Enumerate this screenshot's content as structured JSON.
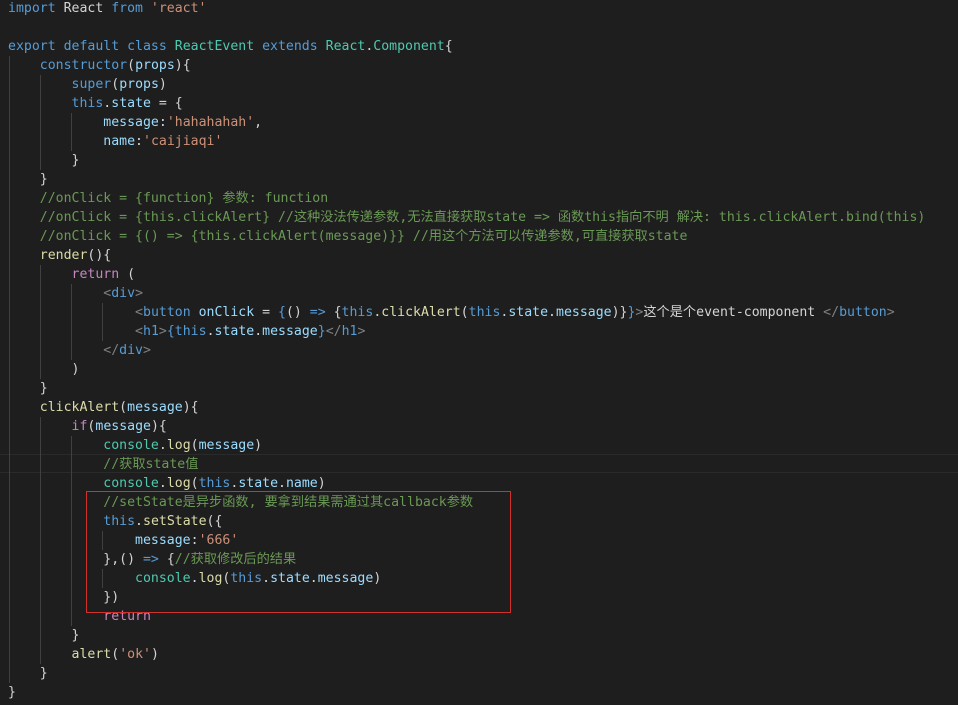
{
  "editor": {
    "theme": {
      "background": "#1e1e1e",
      "keyword": "#569cd6",
      "control": "#c586c0",
      "type": "#4ec9b0",
      "function": "#dcdcaa",
      "variable": "#9cdcfe",
      "string": "#ce9178",
      "comment": "#6a9955",
      "highlight_box": "#d0312d"
    },
    "lines": [
      [
        [
          "kw",
          "import "
        ],
        [
          "pl",
          "React "
        ],
        [
          "kw",
          "from "
        ],
        [
          "st",
          "'react'"
        ]
      ],
      [],
      [
        [
          "kw",
          "export "
        ],
        [
          "kw",
          "default "
        ],
        [
          "kw",
          "class "
        ],
        [
          "ty",
          "ReactEvent "
        ],
        [
          "kw",
          "extends "
        ],
        [
          "ty",
          "React"
        ],
        [
          "pl",
          "."
        ],
        [
          "ty",
          "Component"
        ],
        [
          "pl",
          "{"
        ]
      ],
      [
        [
          "pl",
          "    "
        ],
        [
          "kw",
          "constructor"
        ],
        [
          "pl",
          "("
        ],
        [
          "va",
          "props"
        ],
        [
          "pl",
          "){"
        ]
      ],
      [
        [
          "pl",
          "        "
        ],
        [
          "kw",
          "super"
        ],
        [
          "pl",
          "("
        ],
        [
          "va",
          "props"
        ],
        [
          "pl",
          ")"
        ]
      ],
      [
        [
          "pl",
          "        "
        ],
        [
          "kw",
          "this"
        ],
        [
          "pl",
          "."
        ],
        [
          "va",
          "state"
        ],
        [
          "pl",
          " = {"
        ]
      ],
      [
        [
          "pl",
          "            "
        ],
        [
          "va",
          "message"
        ],
        [
          "pl",
          ":"
        ],
        [
          "st",
          "'hahahahah'"
        ],
        [
          "pl",
          ","
        ]
      ],
      [
        [
          "pl",
          "            "
        ],
        [
          "va",
          "name"
        ],
        [
          "pl",
          ":"
        ],
        [
          "st",
          "'caijiaqi'"
        ]
      ],
      [
        [
          "pl",
          "        }"
        ]
      ],
      [
        [
          "pl",
          "    }"
        ]
      ],
      [
        [
          "pl",
          "    "
        ],
        [
          "cm",
          "//onClick = {function} 参数: function"
        ]
      ],
      [
        [
          "pl",
          "    "
        ],
        [
          "cm",
          "//onClick = {this.clickAlert} //这种没法传递参数,无法直接获取state => 函数this指向不明 解决: this.clickAlert.bind(this)"
        ]
      ],
      [
        [
          "pl",
          "    "
        ],
        [
          "cm",
          "//onClick = {() => {this.clickAlert(message)}} //用这个方法可以传递参数,可直接获取state"
        ]
      ],
      [
        [
          "pl",
          "    "
        ],
        [
          "fn",
          "render"
        ],
        [
          "pl",
          "(){"
        ]
      ],
      [
        [
          "pl",
          "        "
        ],
        [
          "ctl",
          "return"
        ],
        [
          "pl",
          " ("
        ]
      ],
      [
        [
          "pl",
          "            "
        ],
        [
          "br",
          "<"
        ],
        [
          "tg",
          "div"
        ],
        [
          "br",
          ">"
        ]
      ],
      [
        [
          "pl",
          "                "
        ],
        [
          "br",
          "<"
        ],
        [
          "tg",
          "button "
        ],
        [
          "va",
          "onClick"
        ],
        [
          "pl",
          " = "
        ],
        [
          "kw",
          "{"
        ],
        [
          "pl",
          "() "
        ],
        [
          "kw",
          "=>"
        ],
        [
          "pl",
          " {"
        ],
        [
          "kw",
          "this"
        ],
        [
          "pl",
          "."
        ],
        [
          "fn",
          "clickAlert"
        ],
        [
          "pl",
          "("
        ],
        [
          "kw",
          "this"
        ],
        [
          "pl",
          "."
        ],
        [
          "va",
          "state"
        ],
        [
          "pl",
          "."
        ],
        [
          "va",
          "message"
        ],
        [
          "pl",
          ")}"
        ],
        [
          "kw",
          "}"
        ],
        [
          "br",
          ">"
        ],
        [
          "pl",
          "这个是个event-component "
        ],
        [
          "br",
          "</"
        ],
        [
          "tg",
          "button"
        ],
        [
          "br",
          ">"
        ]
      ],
      [
        [
          "pl",
          "                "
        ],
        [
          "br",
          "<"
        ],
        [
          "tg",
          "h1"
        ],
        [
          "br",
          ">"
        ],
        [
          "kw",
          "{"
        ],
        [
          "kw",
          "this"
        ],
        [
          "pl",
          "."
        ],
        [
          "va",
          "state"
        ],
        [
          "pl",
          "."
        ],
        [
          "va",
          "message"
        ],
        [
          "kw",
          "}"
        ],
        [
          "br",
          "</"
        ],
        [
          "tg",
          "h1"
        ],
        [
          "br",
          ">"
        ]
      ],
      [
        [
          "pl",
          "            "
        ],
        [
          "br",
          "</"
        ],
        [
          "tg",
          "div"
        ],
        [
          "br",
          ">"
        ]
      ],
      [
        [
          "pl",
          "        )"
        ]
      ],
      [
        [
          "pl",
          "    }"
        ]
      ],
      [
        [
          "pl",
          "    "
        ],
        [
          "fn",
          "clickAlert"
        ],
        [
          "pl",
          "("
        ],
        [
          "va",
          "message"
        ],
        [
          "pl",
          "){"
        ]
      ],
      [
        [
          "pl",
          "        "
        ],
        [
          "ctl",
          "if"
        ],
        [
          "pl",
          "("
        ],
        [
          "va",
          "message"
        ],
        [
          "pl",
          "){"
        ]
      ],
      [
        [
          "pl",
          "            "
        ],
        [
          "ty",
          "console"
        ],
        [
          "pl",
          "."
        ],
        [
          "fn",
          "log"
        ],
        [
          "pl",
          "("
        ],
        [
          "va",
          "message"
        ],
        [
          "pl",
          ")"
        ]
      ],
      [
        [
          "pl",
          "            "
        ],
        [
          "cm",
          "//获取state值"
        ]
      ],
      [
        [
          "pl",
          "            "
        ],
        [
          "ty",
          "console"
        ],
        [
          "pl",
          "."
        ],
        [
          "fn",
          "log"
        ],
        [
          "pl",
          "("
        ],
        [
          "kw",
          "this"
        ],
        [
          "pl",
          "."
        ],
        [
          "va",
          "state"
        ],
        [
          "pl",
          "."
        ],
        [
          "va",
          "name"
        ],
        [
          "pl",
          ")"
        ]
      ],
      [
        [
          "pl",
          "            "
        ],
        [
          "cm",
          "//setState是异步函数, 要拿到结果需通过其callback参数"
        ]
      ],
      [
        [
          "pl",
          "            "
        ],
        [
          "kw",
          "this"
        ],
        [
          "pl",
          "."
        ],
        [
          "fn",
          "setState"
        ],
        [
          "pl",
          "({"
        ]
      ],
      [
        [
          "pl",
          "                "
        ],
        [
          "va",
          "message"
        ],
        [
          "pl",
          ":"
        ],
        [
          "st",
          "'666'"
        ]
      ],
      [
        [
          "pl",
          "            },() "
        ],
        [
          "kw",
          "=>"
        ],
        [
          "pl",
          " {"
        ],
        [
          "cm",
          "//获取修改后的结果"
        ]
      ],
      [
        [
          "pl",
          "                "
        ],
        [
          "ty",
          "console"
        ],
        [
          "pl",
          "."
        ],
        [
          "fn",
          "log"
        ],
        [
          "pl",
          "("
        ],
        [
          "kw",
          "this"
        ],
        [
          "pl",
          "."
        ],
        [
          "va",
          "state"
        ],
        [
          "pl",
          "."
        ],
        [
          "va",
          "message"
        ],
        [
          "pl",
          ")"
        ]
      ],
      [
        [
          "pl",
          "            })"
        ]
      ],
      [
        [
          "pl",
          "            "
        ],
        [
          "ctl",
          "return"
        ]
      ],
      [
        [
          "pl",
          "        }"
        ]
      ],
      [
        [
          "pl",
          "        "
        ],
        [
          "fn",
          "alert"
        ],
        [
          "pl",
          "("
        ],
        [
          "st",
          "'ok'"
        ],
        [
          "pl",
          ")"
        ]
      ],
      [
        [
          "pl",
          "    }"
        ]
      ],
      [
        [
          "pl",
          "}"
        ]
      ]
    ]
  }
}
